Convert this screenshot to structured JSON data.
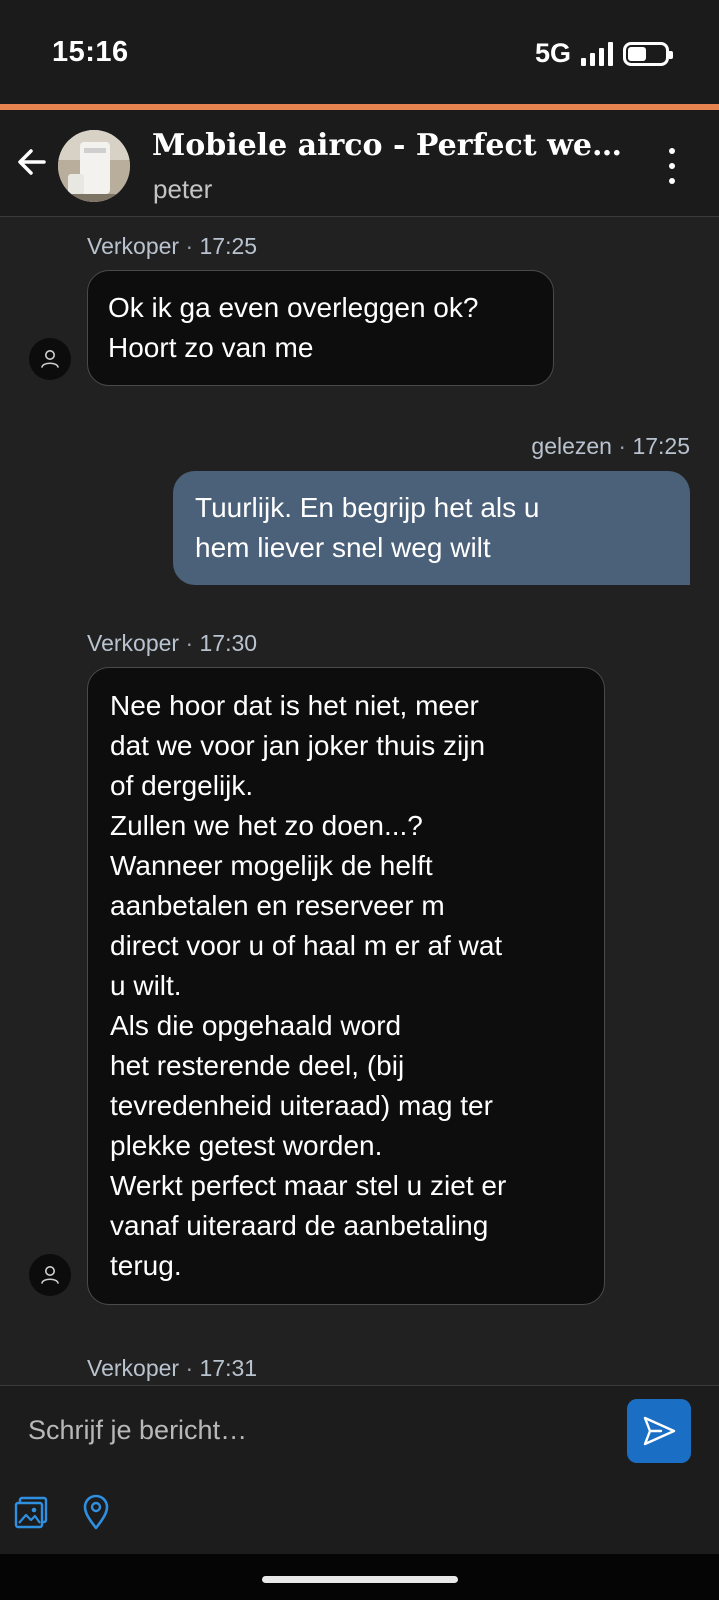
{
  "status_bar": {
    "time": "15:16",
    "network": "5G",
    "signal_bars": 4,
    "battery_level": 0.55
  },
  "header": {
    "title": "Mobiele airco - Perfect wer…",
    "subtitle": "peter",
    "back_icon": "arrow-left-icon",
    "menu_icon": "more-vertical-icon",
    "thumbnail": "product-thumbnail-airco"
  },
  "messages": [
    {
      "direction": "incoming",
      "sender": "Verkoper",
      "separator": " · ",
      "time": "17:25",
      "text": "Ok ik ga even overleggen ok?\nHoort zo van me"
    },
    {
      "direction": "outgoing",
      "status": "gelezen",
      "separator": " · ",
      "time": "17:25",
      "text": "Tuurlijk. En begrijp het als u\nhem liever snel weg wilt"
    },
    {
      "direction": "incoming",
      "sender": "Verkoper",
      "separator": " · ",
      "time": "17:30",
      "text": "Nee hoor dat is het niet, meer\ndat we voor jan joker thuis zijn\nof dergelijk.\nZullen we het zo doen...?\nWanneer mogelijk de helft\naanbetalen en reserveer m\ndirect voor u of haal m er af wat\nu wilt.\nAls die opgehaald word\nhet resterende deel, (bij\ntevredenheid uiteraad) mag ter\nplekke getest worden.\nWerkt perfect maar stel u ziet er\nvanaf uiteraard de aanbetaling\nterug."
    },
    {
      "direction": "incoming",
      "sender": "Verkoper",
      "separator": " · ",
      "time": "17:31",
      "text": ""
    }
  ],
  "composer": {
    "placeholder": "Schrijf je bericht…",
    "value": "",
    "send_icon": "send-icon"
  },
  "attachments": {
    "icons": [
      "image-gallery-icon",
      "location-pin-icon"
    ]
  },
  "colors": {
    "accent": "#e7834f",
    "outgoing_bubble": "#4b6079",
    "incoming_bubble": "#0d0d0d",
    "send_button": "#1a6fc4",
    "icon_blue": "#2f8fe0"
  }
}
